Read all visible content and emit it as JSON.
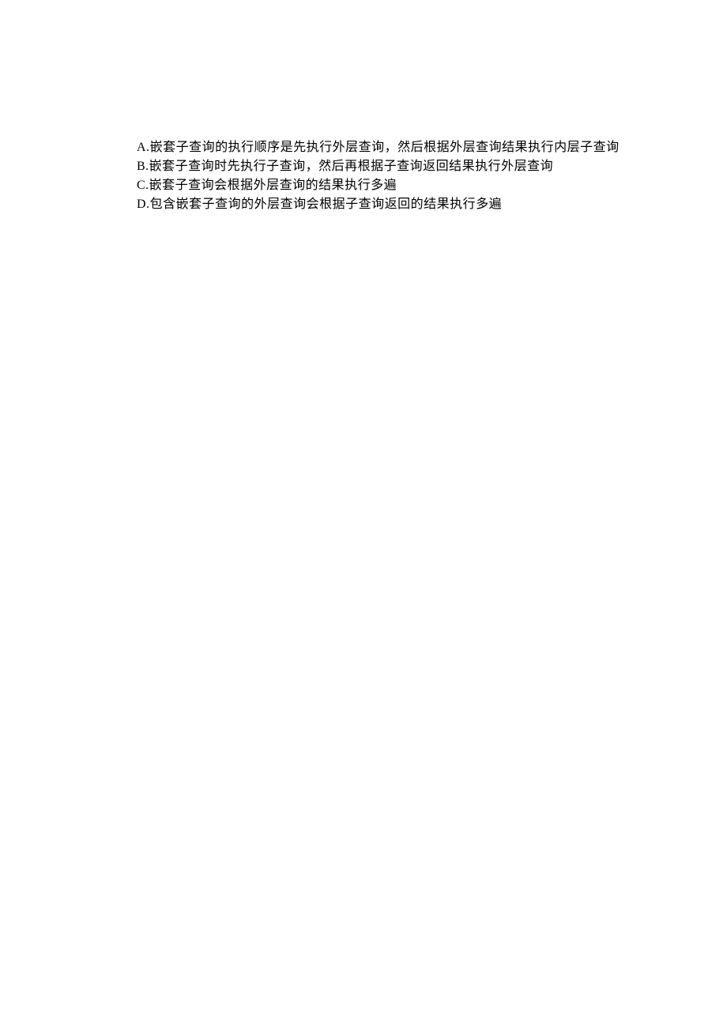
{
  "options": [
    {
      "label": "A.",
      "text": "嵌套子查询的执行顺序是先执行外层查询，然后根据外层查询结果执行内层子查询"
    },
    {
      "label": "B.",
      "text": "嵌套子查询时先执行子查询，然后再根据子查询返回结果执行外层查询"
    },
    {
      "label": "C.",
      "text": "嵌套子查询会根据外层查询的结果执行多遍"
    },
    {
      "label": "D.",
      "text": "包含嵌套子查询的外层查询会根据子查询返回的结果执行多遍"
    }
  ]
}
